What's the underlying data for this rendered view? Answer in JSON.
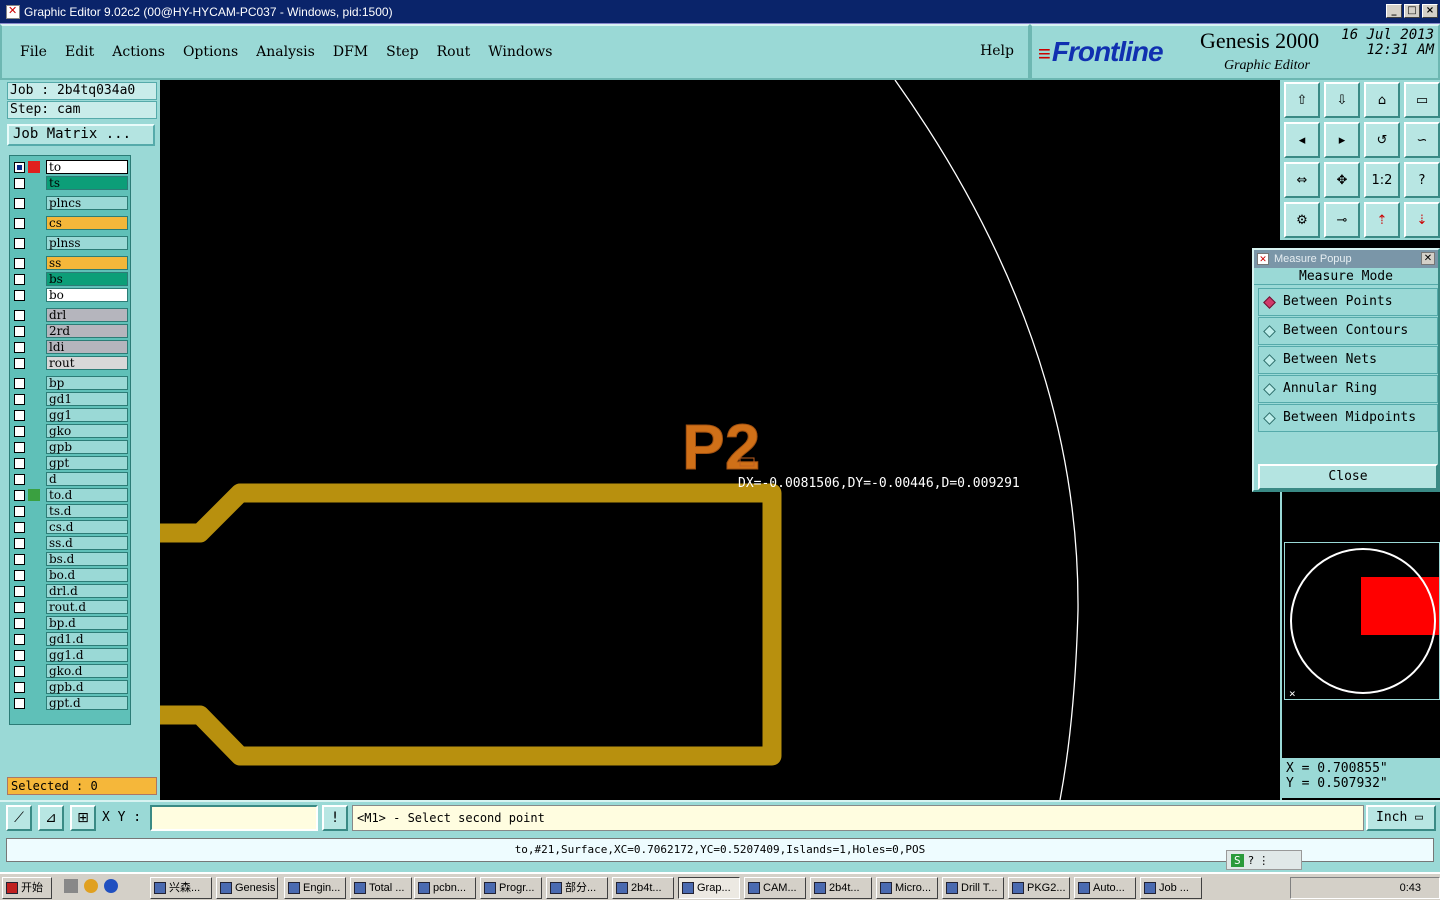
{
  "window": {
    "title": "Graphic Editor 9.02c2 (00@HY-HYCAM-PC037 - Windows, pid:1500)"
  },
  "menu": {
    "items": [
      "File",
      "Edit",
      "Actions",
      "Options",
      "Analysis",
      "DFM",
      "Step",
      "Rout",
      "Windows"
    ],
    "help": "Help"
  },
  "brand": {
    "logo": "Frontline",
    "product": "Genesis 2000",
    "subtitle": "Graphic Editor",
    "date": "16 Jul 2013",
    "time": "12:31 AM"
  },
  "job": {
    "job_line": "Job : 2b4tq034a0",
    "step_line": "Step: cam",
    "matrix_button": "Job Matrix ..."
  },
  "layers": [
    {
      "name": "to",
      "color": "#ffffff",
      "cbox": "#e0201e",
      "sel": true
    },
    {
      "name": "ts",
      "color": "#0c9e78",
      "cbox": ""
    },
    {
      "name": "plncs",
      "color": "#9ad9d6",
      "cbox": ""
    },
    {
      "name": "cs",
      "color": "#f5b73a",
      "cbox": ""
    },
    {
      "name": "plnss",
      "color": "#9ad9d6",
      "cbox": ""
    },
    {
      "name": "ss",
      "color": "#f5b73a",
      "cbox": ""
    },
    {
      "name": "bs",
      "color": "#0c9e78",
      "cbox": ""
    },
    {
      "name": "bo",
      "color": "#ffffff",
      "cbox": ""
    },
    {
      "name": "drl",
      "color": "#b5b5bd",
      "cbox": ""
    },
    {
      "name": "2rd",
      "color": "#b5b5bd",
      "cbox": ""
    },
    {
      "name": "ldi",
      "color": "#b5b5bd",
      "cbox": ""
    },
    {
      "name": "rout",
      "color": "#d8d8d8",
      "cbox": ""
    },
    {
      "name": "bp",
      "color": "#9ad9d6",
      "cbox": ""
    },
    {
      "name": "gd1",
      "color": "#9ad9d6",
      "cbox": "",
      "mark": true
    },
    {
      "name": "gg1",
      "color": "#9ad9d6",
      "cbox": ""
    },
    {
      "name": "gko",
      "color": "#9ad9d6",
      "cbox": "",
      "mark": true
    },
    {
      "name": "gpb",
      "color": "#9ad9d6",
      "cbox": ""
    },
    {
      "name": "gpt",
      "color": "#9ad9d6",
      "cbox": ""
    },
    {
      "name": "d",
      "color": "#9ad9d6",
      "cbox": ""
    },
    {
      "name": "to.d",
      "color": "#9ad9d6",
      "cbox": "#3aa040"
    },
    {
      "name": "ts.d",
      "color": "#9ad9d6",
      "cbox": ""
    },
    {
      "name": "cs.d",
      "color": "#9ad9d6",
      "cbox": ""
    },
    {
      "name": "ss.d",
      "color": "#9ad9d6",
      "cbox": ""
    },
    {
      "name": "bs.d",
      "color": "#9ad9d6",
      "cbox": ""
    },
    {
      "name": "bo.d",
      "color": "#9ad9d6",
      "cbox": ""
    },
    {
      "name": "drl.d",
      "color": "#9ad9d6",
      "cbox": ""
    },
    {
      "name": "rout.d",
      "color": "#9ad9d6",
      "cbox": ""
    },
    {
      "name": "bp.d",
      "color": "#9ad9d6",
      "cbox": ""
    },
    {
      "name": "gd1.d",
      "color": "#9ad9d6",
      "cbox": "",
      "mark": true
    },
    {
      "name": "gg1.d",
      "color": "#9ad9d6",
      "cbox": ""
    },
    {
      "name": "gko.d",
      "color": "#9ad9d6",
      "cbox": "",
      "mark": true
    },
    {
      "name": "gpb.d",
      "color": "#9ad9d6",
      "cbox": ""
    },
    {
      "name": "gpt.d",
      "color": "#9ad9d6",
      "cbox": ""
    }
  ],
  "selected": "Selected : 0",
  "canvas": {
    "label": "P2",
    "measure_text": "DX=-0.0081506,DY=-0.00446,D=0.009291",
    "trace_color": "#b8900e",
    "label_color": "#d07018"
  },
  "measure_popup": {
    "title": "Measure Popup",
    "header": "Measure Mode",
    "options": [
      "Between Points",
      "Between Contours",
      "Between Nets",
      "Annular Ring",
      "Between Midpoints"
    ],
    "selected_index": 0,
    "close": "Close"
  },
  "toolbar_icons": [
    "zoom-home-icon",
    "zoom-to-icon",
    "house-icon",
    "window-icon",
    "pan-left-icon",
    "pan-right-icon",
    "undo-icon",
    "snap-icon",
    "fit-icon",
    "fit-all-icon",
    "scale-1-2-icon",
    "help-icon",
    "tools-icon",
    "probe-icon",
    "layer-up-icon",
    "layer-down-icon"
  ],
  "toolbar_labels": {
    "scale": "1:2",
    "help": "?"
  },
  "coords": {
    "x": "X = 0.700855\"",
    "y": "Y = 0.507932\""
  },
  "cmd": {
    "xy_label": "X Y :",
    "xy_value": "",
    "prompt": "<M1> - Select second point",
    "unit": "Inch"
  },
  "status": "to,#21,Surface,XC=0.7062172,YC=0.5207409,Islands=1,Holes=0,POS",
  "taskbar": {
    "start": "开始",
    "items": [
      "兴森...",
      "Genesis",
      "Engin...",
      "Total ...",
      "pcbn...",
      "Progr...",
      "部分...",
      "2b4t...",
      "Grap...",
      "CAM...",
      "2b4t...",
      "Micro...",
      "Drill T...",
      "PKG2...",
      "Auto...",
      "Job ..."
    ],
    "active_index": 8,
    "clock": "0:43"
  }
}
